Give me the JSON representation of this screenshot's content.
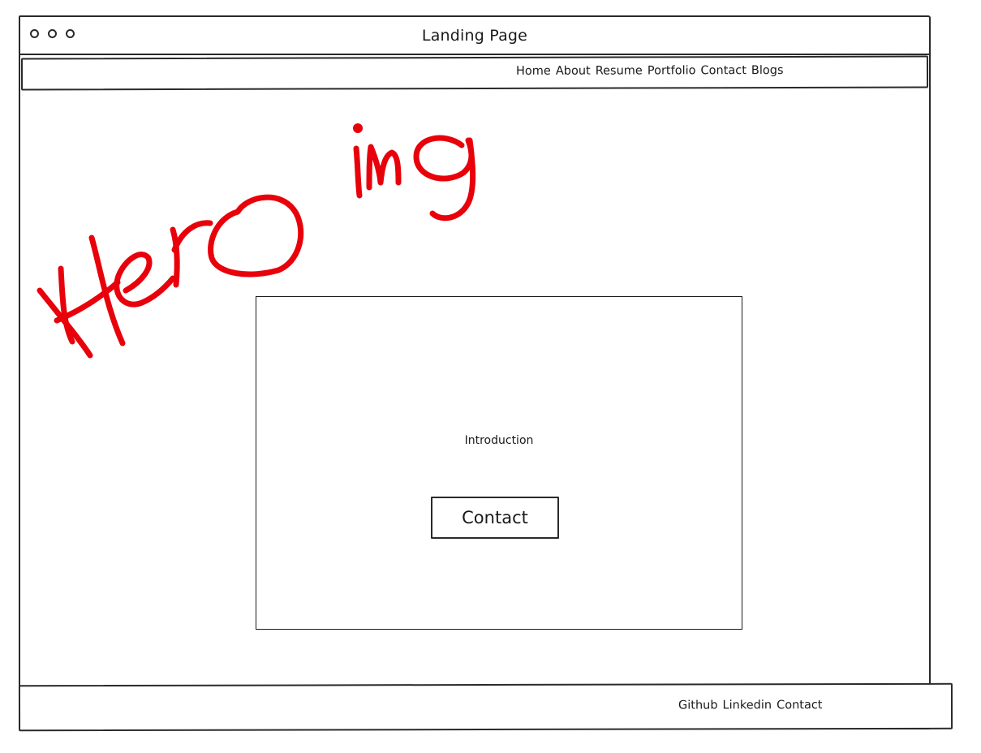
{
  "window": {
    "title": "Landing Page",
    "controls": [
      "window-dot",
      "window-dot",
      "window-dot"
    ]
  },
  "nav": {
    "links": [
      "Home",
      "About",
      "Resume",
      "Portfolio",
      "Contact",
      "Blogs"
    ]
  },
  "hero": {
    "annotation": "Hero img",
    "annotation_color": "#e8000b"
  },
  "intro": {
    "text": "Introduction",
    "button_label": "Contact"
  },
  "footer": {
    "links": [
      "Github",
      "Linkedin",
      "Contact"
    ]
  }
}
